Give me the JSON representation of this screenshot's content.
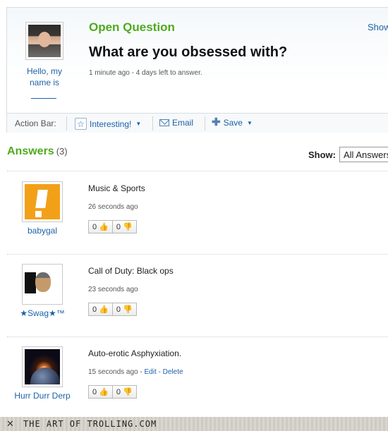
{
  "question": {
    "header": "Open Question",
    "show_link": "Show",
    "title": "What are you obsessed with?",
    "meta": "1 minute ago - 4 days left to answer.",
    "asker_name": "Hello, my name is"
  },
  "action_bar": {
    "label": "Action Bar:",
    "interesting": "Interesting!",
    "email": "Email",
    "save": "Save"
  },
  "answers_header": {
    "title": "Answers",
    "count": "(3)",
    "show_label": "Show:",
    "show_value": "All Answers"
  },
  "answers": [
    {
      "user": "babygal",
      "text": "Music & Sports",
      "time": "26 seconds ago",
      "thumbs_up": "0",
      "thumbs_down": "0"
    },
    {
      "user": "★Swag★™",
      "text": "Call of Duty: Black ops",
      "time": "23 seconds ago",
      "thumbs_up": "0",
      "thumbs_down": "0"
    },
    {
      "user": "Hurr Durr Derp",
      "text": "Auto-erotic Asphyxiation.",
      "time": "15 seconds ago - ",
      "edit": "Edit",
      "sep": " - ",
      "delete": "Delete",
      "thumbs_up": "0",
      "thumbs_down": "0"
    }
  ],
  "footer": {
    "text": "THE ART OF TROLLING.COM"
  },
  "icons": {
    "star": "star-icon",
    "email": "envelope-icon",
    "save": "plus-icon",
    "thumbs_up": "thumbs-up-icon",
    "thumbs_down": "thumbs-down-icon"
  },
  "colors": {
    "green": "#4faa1d",
    "link": "#1d62a8"
  }
}
